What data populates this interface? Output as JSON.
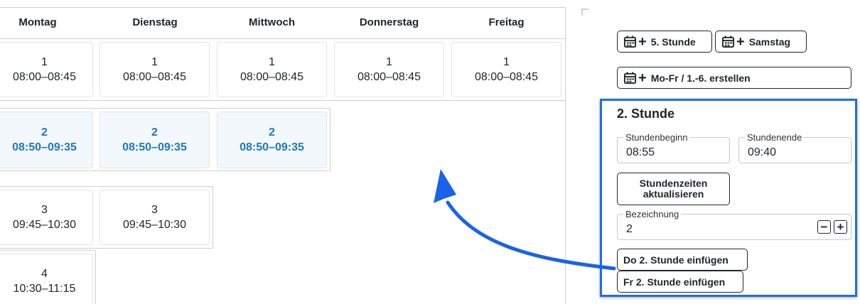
{
  "days": [
    "Montag",
    "Dienstag",
    "Mittwoch",
    "Donnerstag",
    "Freitag"
  ],
  "rows": [
    {
      "label": "1",
      "time": "08:00–08:45",
      "days": [
        0,
        1,
        2,
        3,
        4
      ],
      "selected": false
    },
    {
      "label": "2",
      "time": "08:50–09:35",
      "days": [
        0,
        1,
        2
      ],
      "selected": true
    },
    {
      "label": "3",
      "time": "09:45–10:30",
      "days": [
        0,
        1
      ],
      "selected": false
    },
    {
      "label": "4",
      "time": "10:30–11:15",
      "days": [
        0
      ],
      "selected": false
    }
  ],
  "toolbar": {
    "add_5th": "5. Stunde",
    "add_saturday": "Samstag",
    "create_all": "Mo-Fr / 1.-6. erstellen",
    "calendar_icon": "calendar-plus-icon"
  },
  "editor": {
    "title": "2. Stunde",
    "start_label": "Stundenbeginn",
    "start_value": "08:55",
    "end_label": "Stundenende",
    "end_value": "09:40",
    "update_button": "Stundenzeiten aktualisieren",
    "name_label": "Bezeichnung",
    "name_value": "2",
    "minus": "−",
    "plus": "+",
    "insert_do": "Do 2. Stunde einfügen",
    "insert_fr": "Fr 2. Stunde einfügen"
  },
  "colors": {
    "accent": "#1b78c2",
    "highlight_border": "#1e6ee6",
    "arrow": "#1a62e8"
  }
}
